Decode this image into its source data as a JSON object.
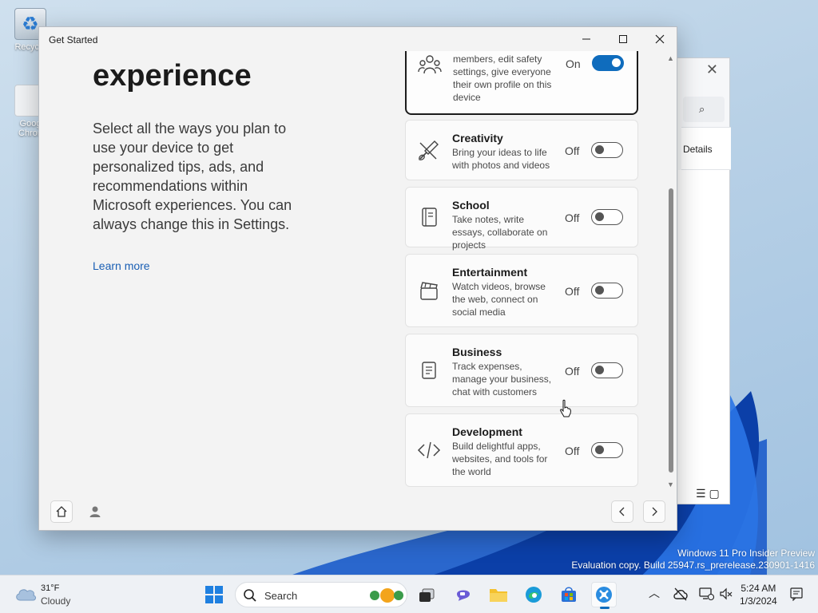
{
  "desktop": {
    "recycle_label": "Recycle",
    "chrome_label_1": "Goog",
    "chrome_label_2": "Chron"
  },
  "bg_window": {
    "details_label": "Details"
  },
  "window": {
    "title": "Get Started",
    "heading": "experience",
    "description": "Select all the ways you plan to use your device to get personalized tips, ads, and recommendations within Microsoft experiences. You can always change this in Settings.",
    "learn_more": "Learn more"
  },
  "cards": [
    {
      "name": "",
      "desc": "members, edit safety settings, give everyone their own profile on this device",
      "state": "On",
      "on": true,
      "icon": "family-icon"
    },
    {
      "name": "Creativity",
      "desc": "Bring your ideas to life with photos and videos",
      "state": "Off",
      "on": false,
      "icon": "paintbrush-icon"
    },
    {
      "name": "School",
      "desc": "Take notes, write essays, collaborate on projects",
      "state": "Off",
      "on": false,
      "icon": "notebook-icon"
    },
    {
      "name": "Entertainment",
      "desc": "Watch videos, browse the web, connect on social media",
      "state": "Off",
      "on": false,
      "icon": "clapperboard-icon"
    },
    {
      "name": "Business",
      "desc": "Track expenses, manage your business, chat with customers",
      "state": "Off",
      "on": false,
      "icon": "document-icon"
    },
    {
      "name": "Development",
      "desc": "Build delightful apps, websites, and tools for the world",
      "state": "Off",
      "on": false,
      "icon": "code-icon"
    }
  ],
  "watermark": {
    "line1": "Windows 11 Pro Insider Preview",
    "line2": "Evaluation copy. Build 25947.rs_prerelease.230901-1416"
  },
  "taskbar": {
    "temp": "31°F",
    "condition": "Cloudy",
    "search_placeholder": "Search",
    "time": "5:24 AM",
    "date": "1/3/2024"
  },
  "colors": {
    "accent": "#0f6cbd",
    "link": "#1a5fb4"
  }
}
